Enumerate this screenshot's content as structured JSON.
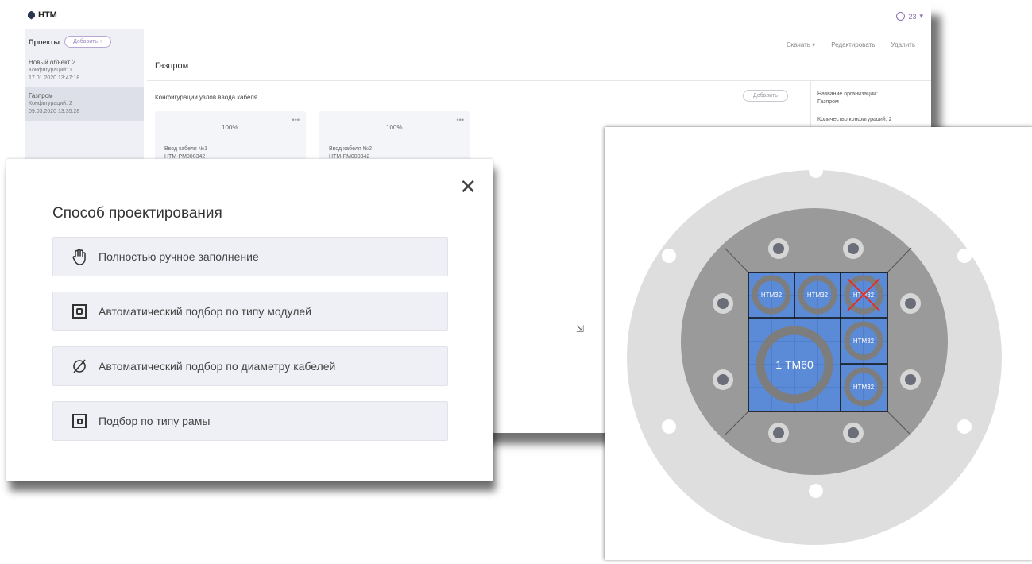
{
  "app": {
    "logo": "НТМ",
    "user": "23",
    "sidebar": {
      "title": "Проекты",
      "add_button": "Добавить",
      "projects": [
        {
          "title": "Новый объект 2",
          "configs": "Конфигураций: 1",
          "date": "17.01.2020 13:47:18"
        },
        {
          "title": "Газпром",
          "configs": "Конфигураций: 2",
          "date": "09.03.2020 13:35:28"
        }
      ]
    },
    "toolbar": {
      "download": "Скачать",
      "edit": "Редактировать",
      "delete": "Удалить"
    },
    "page_title": "Газпром",
    "section_title": "Конфигурации узлов ввода кабеля",
    "add_config_button": "Добавить",
    "cards": [
      {
        "percent": "100%",
        "name": "Ввод кабеля №1",
        "code": "НТМ-РМ000342"
      },
      {
        "percent": "100%",
        "name": "Ввод кабеля №2",
        "code": "НТМ-РМ000342"
      }
    ],
    "info": {
      "org_label": "Название организации:",
      "org_value": "Газпром",
      "config_count": "Количество конфигураций: 2"
    }
  },
  "modal": {
    "title": "Способ проектирования",
    "close_icon": "close-icon",
    "options": [
      {
        "label": "Полностью ручное заполнение",
        "icon": "hand-icon"
      },
      {
        "label": "Автоматический подбор по типу модулей",
        "icon": "module-type-icon"
      },
      {
        "label": "Автоматический подбор по диаметру кабелей",
        "icon": "diameter-icon"
      },
      {
        "label": "Подбор по типу рамы",
        "icon": "frame-type-icon"
      }
    ]
  },
  "diagram": {
    "module_big": "1 ТМ60",
    "module_small_1": "НТМ32",
    "module_small_2": "НТМ32",
    "module_small_3": "НТМ32",
    "module_small_4": "НТМ32",
    "module_small_5": "НТМ32",
    "colors": {
      "outer_flange": "#dedede",
      "inner_plate": "#9a9a9a",
      "frame_grid": "#5b8ad6",
      "grid_line": "#3e6dbd",
      "bolt": "#6b6d78",
      "cross": "#e0302a"
    }
  }
}
